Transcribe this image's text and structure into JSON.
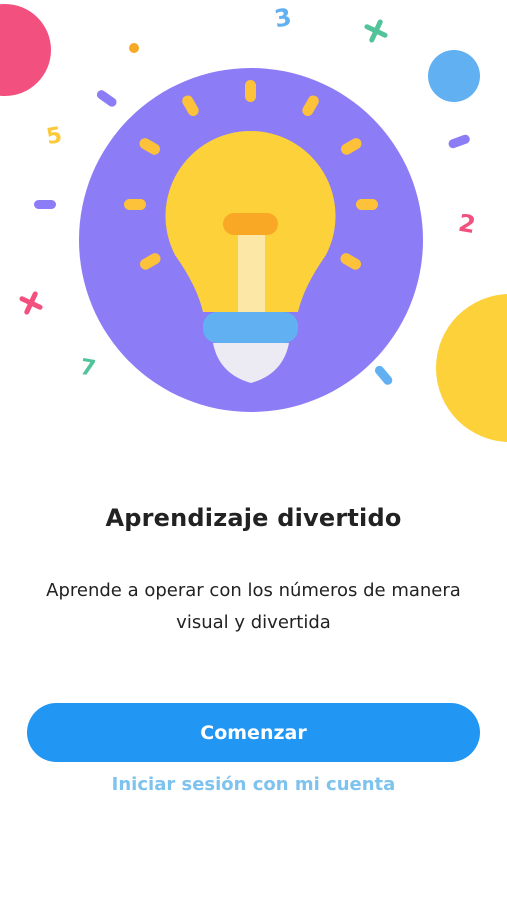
{
  "onboarding": {
    "title": "Aprendizaje divertido",
    "subtitle": "Aprende a operar con los números de manera visual y divertida",
    "primary_button_label": "Comenzar",
    "secondary_link_label": "Iniciar sesión con mi cuenta"
  },
  "decorations": {
    "numbers": [
      "3",
      "5",
      "2",
      "7"
    ]
  },
  "colors": {
    "primary": "#2196f3",
    "link": "#7ec2ee",
    "circle_purple": "#8c7cf5",
    "bulb_yellow": "#fdd13a",
    "accent_pink": "#f2517f",
    "accent_blue": "#61b0f1"
  },
  "icons": {
    "hero": "lightbulb-icon"
  }
}
